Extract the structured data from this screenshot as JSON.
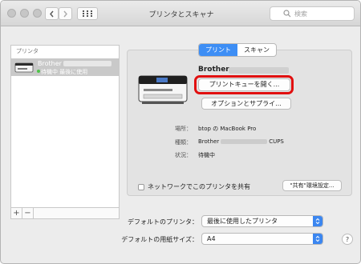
{
  "window": {
    "title": "プリンタとスキャナ"
  },
  "search": {
    "placeholder": "検索"
  },
  "sidebar": {
    "header": "プリンタ",
    "items": [
      {
        "name": "Brother",
        "status": "待機中 最後に使用"
      }
    ]
  },
  "tabs": [
    {
      "label": "プリント",
      "active": true
    },
    {
      "label": "スキャン",
      "active": false
    }
  ],
  "printer": {
    "name": "Brother",
    "open_queue_label": "プリントキューを開く...",
    "options_label": "オプションとサプライ...",
    "info": [
      {
        "key": "場所：",
        "value": "btop の MacBook Pro"
      },
      {
        "key": "種類：",
        "value_prefix": "Brother",
        "value_suffix": "CUPS"
      },
      {
        "key": "状況：",
        "value": "待機中"
      }
    ],
    "share_label": "ネットワークでこのプリンタを共有",
    "share_checked": false,
    "share_prefs_label": "\"共有\"環境設定..."
  },
  "defaults": {
    "printer_label": "デフォルトのプリンタ：",
    "printer_value": "最後に使用したプリンタ",
    "paper_label": "デフォルトの用紙サイズ：",
    "paper_value": "A4"
  },
  "footer": {
    "add": "+",
    "remove": "−"
  },
  "help": "?",
  "colors": {
    "accent": "#3d8ef5",
    "highlight": "#e10f0f"
  }
}
